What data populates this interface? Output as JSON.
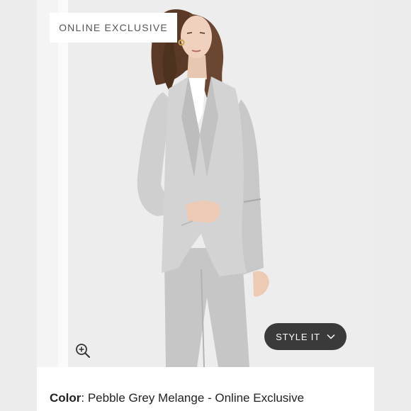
{
  "badge": {
    "label": "ONLINE EXCLUSIVE"
  },
  "style_button": {
    "label": "STYLE IT",
    "icon": "chevron-down-icon"
  },
  "zoom": {
    "icon": "zoom-in-icon"
  },
  "product": {
    "color_label": "Color",
    "color_value": ": Pebble Grey Melange - Online Exclusive"
  },
  "colors": {
    "button_bg": "#3a3a3a",
    "suit": "#c9c9c9",
    "background": "#ededed",
    "hair": "#5a3a26"
  }
}
